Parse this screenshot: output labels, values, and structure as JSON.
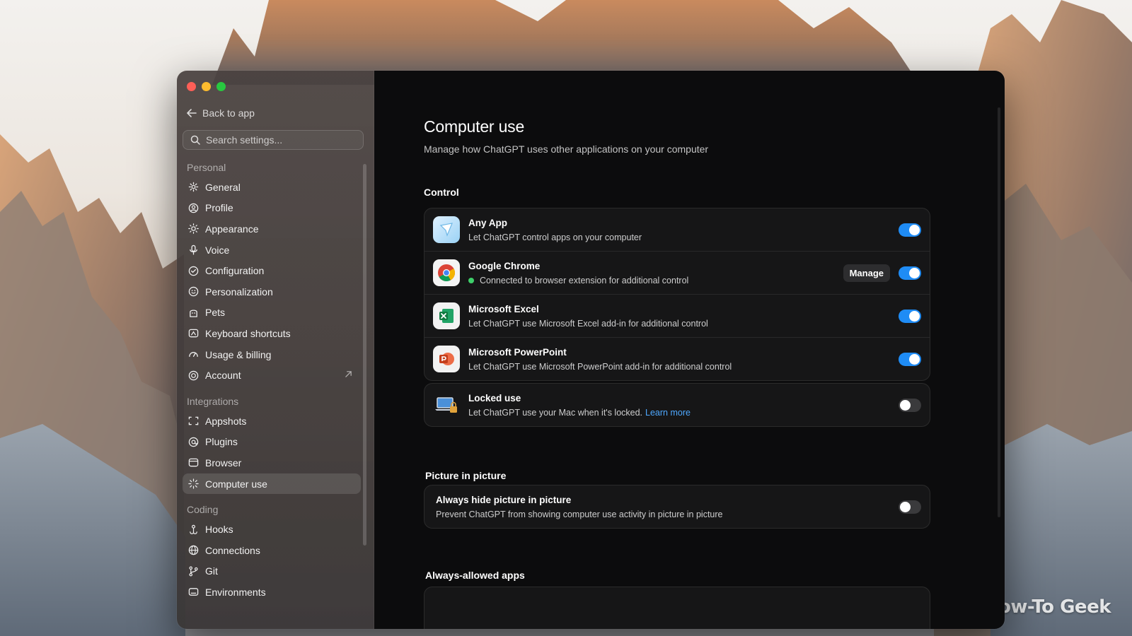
{
  "window": {
    "back_label": "Back to app",
    "search_placeholder": "Search settings..."
  },
  "sidebar": {
    "sections": [
      {
        "title": "Personal",
        "items": [
          {
            "label": "General",
            "icon": "gear-icon"
          },
          {
            "label": "Profile",
            "icon": "profile-icon"
          },
          {
            "label": "Appearance",
            "icon": "sun-icon"
          },
          {
            "label": "Voice",
            "icon": "microphone-icon"
          },
          {
            "label": "Configuration",
            "icon": "configuration-icon"
          },
          {
            "label": "Personalization",
            "icon": "personalization-icon"
          },
          {
            "label": "Pets",
            "icon": "pets-icon"
          },
          {
            "label": "Keyboard shortcuts",
            "icon": "keyboard-icon"
          },
          {
            "label": "Usage & billing",
            "icon": "gauge-icon"
          },
          {
            "label": "Account",
            "icon": "account-icon"
          }
        ]
      },
      {
        "title": "Integrations",
        "items": [
          {
            "label": "Appshots",
            "icon": "appshots-icon"
          },
          {
            "label": "Plugins",
            "icon": "plugins-icon"
          },
          {
            "label": "Browser",
            "icon": "browser-icon"
          },
          {
            "label": "Computer use",
            "icon": "computer-use-icon",
            "active": true
          }
        ]
      },
      {
        "title": "Coding",
        "items": [
          {
            "label": "Hooks",
            "icon": "hook-icon"
          },
          {
            "label": "Connections",
            "icon": "globe-icon"
          },
          {
            "label": "Git",
            "icon": "git-branch-icon"
          },
          {
            "label": "Environments",
            "icon": "environments-icon"
          }
        ]
      }
    ]
  },
  "page": {
    "title": "Computer use",
    "subtitle": "Manage how ChatGPT uses other applications on your computer",
    "control_heading": "Control",
    "control_rows": [
      {
        "title": "Any App",
        "desc": "Let ChatGPT control apps on your computer",
        "enabled": true
      },
      {
        "title": "Google Chrome",
        "desc": "Connected to browser extension for additional control",
        "enabled": true,
        "button": "Manage"
      },
      {
        "title": "Microsoft Excel",
        "desc": "Let ChatGPT use Microsoft Excel add-in for additional control",
        "enabled": true
      },
      {
        "title": "Microsoft PowerPoint",
        "desc": "Let ChatGPT use Microsoft PowerPoint add-in for additional control",
        "enabled": true
      }
    ],
    "locked": {
      "title": "Locked use",
      "desc": "Let ChatGPT use your Mac when it's locked.",
      "link": "Learn more",
      "enabled": false
    },
    "pip_heading": "Picture in picture",
    "pip": {
      "title": "Always hide picture in picture",
      "desc": "Prevent ChatGPT from showing computer use activity in picture in picture",
      "enabled": false
    },
    "allowed_heading": "Always-allowed apps"
  },
  "watermark": "How-To Geek",
  "colors": {
    "accent": "#1f8cf5",
    "link": "#4ea8ff",
    "status_green": "#3ecf6a"
  }
}
